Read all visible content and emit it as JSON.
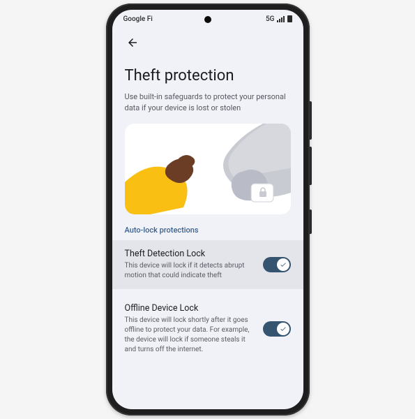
{
  "status": {
    "carrier": "Google Fi",
    "network": "5G"
  },
  "page": {
    "title": "Theft protection",
    "subtitle": "Use built-in safeguards to protect your personal data if your device is lost or stolen",
    "sectionLabel": "Auto-lock protections"
  },
  "settings": [
    {
      "title": "Theft Detection Lock",
      "desc": "This device will lock if it detects abrupt motion that could indicate theft",
      "on": true,
      "highlight": true
    },
    {
      "title": "Offline Device Lock",
      "desc": "This device will lock shortly after it goes offline to protect your data. For example, the device will lock if someone steals it and turns off the internet.",
      "on": true,
      "highlight": false
    }
  ],
  "colors": {
    "accent": "#35546f",
    "screenBg": "#f1f2f7",
    "heroBg": "#ffffff",
    "sectionLabel": "#3a608f"
  }
}
